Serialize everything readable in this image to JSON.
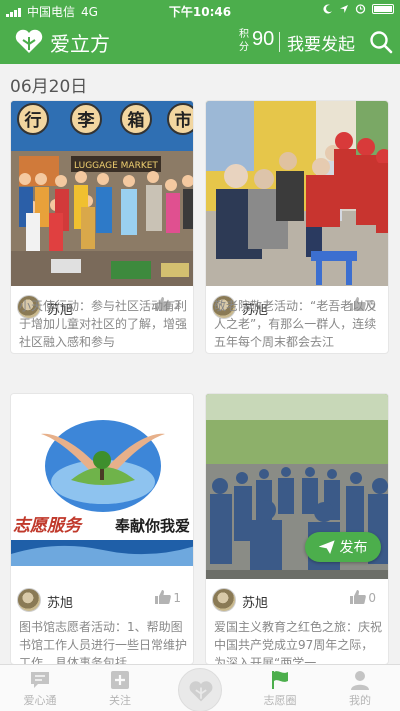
{
  "status_bar": {
    "carrier": "中国电信",
    "network": "4G",
    "time": "下午10:46"
  },
  "nav": {
    "title": "爱立方",
    "points_label": "积分",
    "points_value": "90",
    "initiate_label": "我要发起",
    "search_icon": "search-icon"
  },
  "date_heading": "06月20日",
  "cards": [
    {
      "author": "苏旭",
      "likes": "2",
      "excerpt": "小天使行动：参与社区活动有利于增加儿童对社区的了解，增强社区融入感和参与"
    },
    {
      "author": "苏旭",
      "likes": "0",
      "excerpt": "敬老院敬老活动：“老吾老以及人之老”，有那么一群人，连续五年每个周末都会去江"
    },
    {
      "author": "苏旭",
      "likes": "1",
      "excerpt": "图书馆志愿者活动：1、帮助图书馆工作人员进行一些日常维护工作，具体事务包括"
    },
    {
      "author": "苏旭",
      "likes": "0",
      "excerpt": "爱国主义教育之红色之旅：庆祝中国共产党成立97周年之际，为深入开展“两学一"
    }
  ],
  "photo_texts": {
    "store_sign": [
      "行",
      "李",
      "箱",
      "市"
    ],
    "store_banner": "LUGGAGE MARKET",
    "volunteer_left": "志愿服务",
    "volunteer_right": "奉献你我爱"
  },
  "publish_label": "发布",
  "tabs": [
    {
      "label": "爱心通",
      "icon": "message-icon"
    },
    {
      "label": "关注",
      "icon": "plus-square-icon"
    },
    {
      "label": "",
      "icon": "heart-logo-icon"
    },
    {
      "label": "志愿圈",
      "icon": "flag-icon"
    },
    {
      "label": "我的",
      "icon": "person-icon"
    }
  ],
  "colors": {
    "brand": "#4cae4c",
    "background": "#f2f2f2",
    "muted_text": "#888888",
    "inactive_tab": "#b5b5b5"
  }
}
